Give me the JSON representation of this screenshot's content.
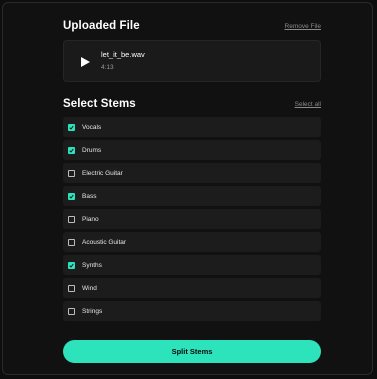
{
  "uploaded": {
    "title": "Uploaded File",
    "remove_label": "Remove File",
    "file_name": "let_it_be.wav",
    "duration": "4:13",
    "play_icon": "play-icon"
  },
  "stems": {
    "title": "Select Stems",
    "select_all_label": "Select all",
    "items": [
      {
        "label": "Vocals",
        "checked": true
      },
      {
        "label": "Drums",
        "checked": true
      },
      {
        "label": "Electric Guitar",
        "checked": false
      },
      {
        "label": "Bass",
        "checked": true
      },
      {
        "label": "Piano",
        "checked": false
      },
      {
        "label": "Acoustic Guitar",
        "checked": false
      },
      {
        "label": "Synths",
        "checked": true
      },
      {
        "label": "Wind",
        "checked": false
      },
      {
        "label": "Strings",
        "checked": false
      }
    ]
  },
  "actions": {
    "split_label": "Split Stems"
  },
  "colors": {
    "accent": "#2de3bb",
    "background": "#111111",
    "row": "#1c1c1c"
  }
}
